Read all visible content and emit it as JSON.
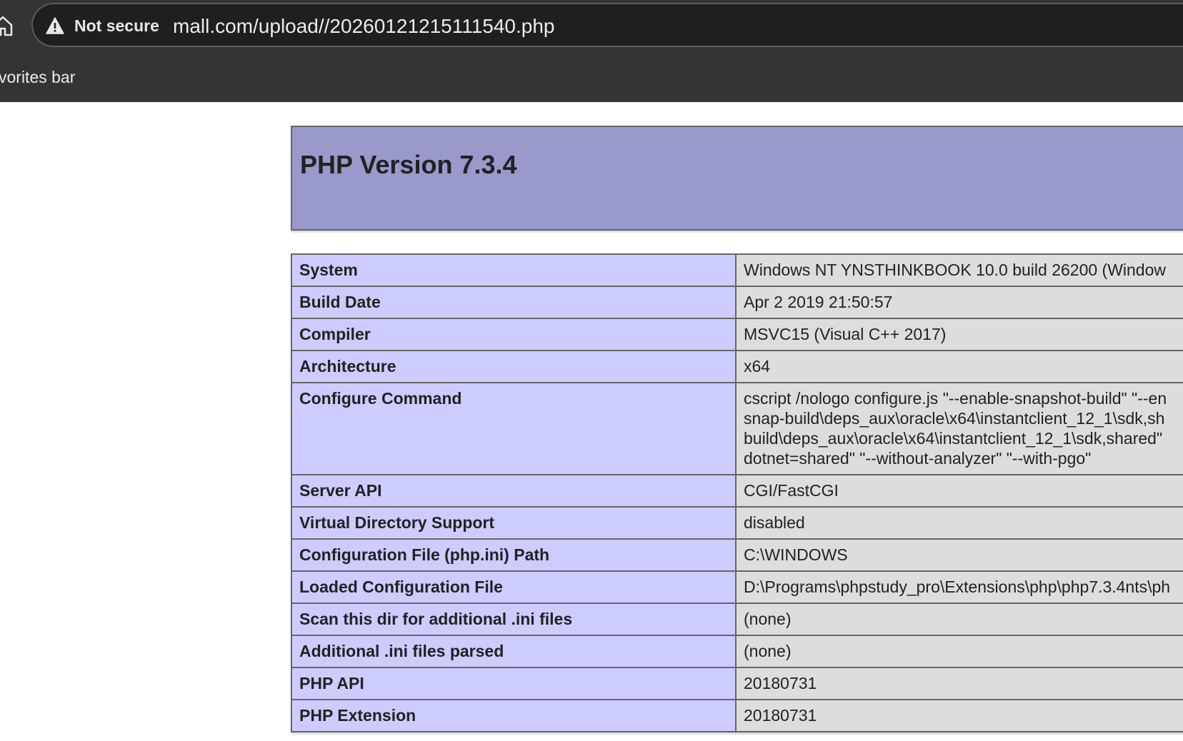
{
  "browser": {
    "security_label": "Not secure",
    "url": "mall.com/upload//20260121215111540.php",
    "favorites_label": "vorites bar"
  },
  "page": {
    "title": "PHP Version 7.3.4",
    "rows": [
      {
        "label": "System",
        "value_lines": [
          "Windows NT YNSTHINKBOOK 10.0 build 26200 (Window"
        ]
      },
      {
        "label": "Build Date",
        "value_lines": [
          "Apr 2 2019 21:50:57"
        ]
      },
      {
        "label": "Compiler",
        "value_lines": [
          "MSVC15 (Visual C++ 2017)"
        ]
      },
      {
        "label": "Architecture",
        "value_lines": [
          "x64"
        ]
      },
      {
        "label": "Configure Command",
        "value_lines": [
          "cscript /nologo configure.js \"--enable-snapshot-build\" \"--en",
          "snap-build\\deps_aux\\oracle\\x64\\instantclient_12_1\\sdk,sh",
          "build\\deps_aux\\oracle\\x64\\instantclient_12_1\\sdk,shared\"",
          "dotnet=shared\" \"--without-analyzer\" \"--with-pgo\""
        ]
      },
      {
        "label": "Server API",
        "value_lines": [
          "CGI/FastCGI"
        ]
      },
      {
        "label": "Virtual Directory Support",
        "value_lines": [
          "disabled"
        ]
      },
      {
        "label": "Configuration File (php.ini) Path",
        "value_lines": [
          "C:\\WINDOWS"
        ]
      },
      {
        "label": "Loaded Configuration File",
        "value_lines": [
          "D:\\Programs\\phpstudy_pro\\Extensions\\php\\php7.3.4nts\\ph"
        ]
      },
      {
        "label": "Scan this dir for additional .ini files",
        "value_lines": [
          "(none)"
        ]
      },
      {
        "label": "Additional .ini files parsed",
        "value_lines": [
          "(none)"
        ]
      },
      {
        "label": "PHP API",
        "value_lines": [
          "20180731"
        ]
      },
      {
        "label": "PHP Extension",
        "value_lines": [
          "20180731"
        ]
      }
    ]
  },
  "colors": {
    "header_bg": "#9999cc",
    "label_bg": "#ccccff",
    "value_bg": "#dddddd",
    "chrome_bg": "#333436"
  },
  "icons": {
    "home": "home-icon",
    "security": "warning-triangle-icon"
  }
}
